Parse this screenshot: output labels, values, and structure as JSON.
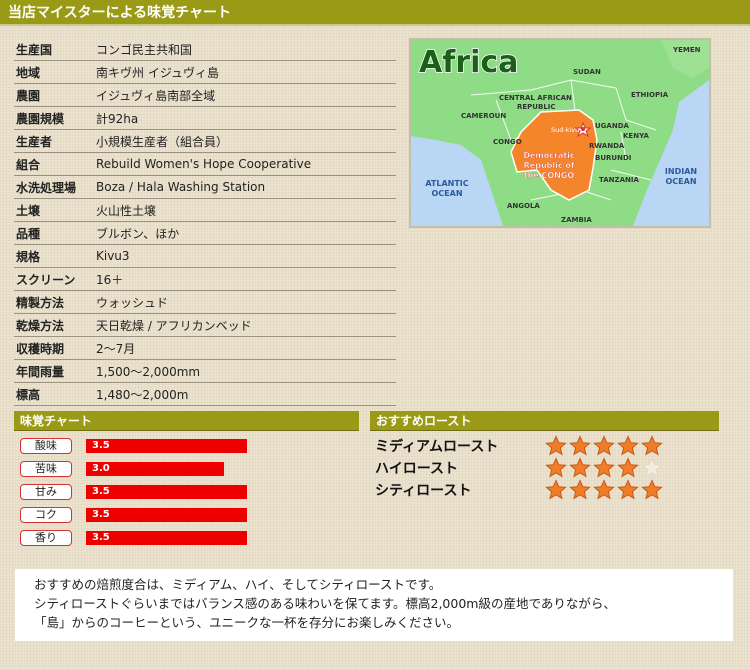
{
  "header": {
    "title": "当店マイスターによる味覚チャート"
  },
  "spec": [
    {
      "label": "生産国",
      "value": "コンゴ民主共和国"
    },
    {
      "label": "地域",
      "value": "南キヴ州 イジュヴィ島"
    },
    {
      "label": "農園",
      "value": "イジュヴィ島南部全域"
    },
    {
      "label": "農園規模",
      "value": "計92ha"
    },
    {
      "label": "生産者",
      "value": "小規模生産者（組合員）"
    },
    {
      "label": "組合",
      "value": "Rebuild Women's Hope Cooperative"
    },
    {
      "label": "水洗処理場",
      "value": "Boza / Hala Washing Station"
    },
    {
      "label": "土壌",
      "value": "火山性土壌"
    },
    {
      "label": "品種",
      "value": "ブルボン、ほか"
    },
    {
      "label": "規格",
      "value": "Kivu3"
    },
    {
      "label": "スクリーン",
      "value": "16＋"
    },
    {
      "label": "精製方法",
      "value": "ウォッシュド"
    },
    {
      "label": "乾燥方法",
      "value": "天日乾燥 / アフリカンベッド"
    },
    {
      "label": "収穫時期",
      "value": "2〜7月"
    },
    {
      "label": "年間雨量",
      "value": "1,500〜2,000mm"
    },
    {
      "label": "標高",
      "value": "1,480〜2,000m"
    }
  ],
  "map": {
    "title": "Africa",
    "labels": {
      "yemen": "YEMEN",
      "sudan": "SUDAN",
      "car1": "CENTRAL AFRICAN",
      "car2": "REPUBLIC",
      "ethiopia": "ETHIOPIA",
      "cameroun": "CAMEROUN",
      "uganda": "UGANDA",
      "kenya": "KENYA",
      "congo": "CONGO",
      "sudkivu": "Sud-kivu",
      "rwanda": "RWANDA",
      "burundi": "BURUNDI",
      "drc1": "Democratic",
      "drc2": "Republic of",
      "drc3": "the CONGO",
      "tanzania": "TANZANIA",
      "atlantic1": "ATLANTIC",
      "atlantic2": "OCEAN",
      "angola": "ANGOLA",
      "zambia": "ZAMBIA",
      "indian1": "INDIAN",
      "indian2": "OCEAN"
    },
    "colors": {
      "land": "#8fdc86",
      "sea": "#b9d7f5",
      "drc": "#f5852a",
      "border": "#ffffff"
    }
  },
  "taste": {
    "heading": "味覚チャート",
    "max": 5,
    "items": [
      {
        "label": "酸味",
        "value": 3.5,
        "text": "3.5"
      },
      {
        "label": "苦味",
        "value": 3.0,
        "text": "3.0"
      },
      {
        "label": "甘み",
        "value": 3.5,
        "text": "3.5"
      },
      {
        "label": "コク",
        "value": 3.5,
        "text": "3.5"
      },
      {
        "label": "香り",
        "value": 3.5,
        "text": "3.5"
      }
    ]
  },
  "roast": {
    "heading": "おすすめロースト",
    "max_stars": 5,
    "items": [
      {
        "name": "ミディアムロースト",
        "stars": 5
      },
      {
        "name": "ハイロースト",
        "stars": 4
      },
      {
        "name": "シティロースト",
        "stars": 5
      }
    ]
  },
  "comment": {
    "lines": [
      "おすすめの焙煎度合は、ミディアム、ハイ、そしてシティローストです。",
      "シティローストぐらいまではバランス感のある味わいを保てます。標高2,000m級の産地でありながら、",
      "「島」からのコーヒーという、ユニークな一杯を存分にお楽しみください。"
    ]
  },
  "colors": {
    "accent": "#9a9a16",
    "bar": "#ee0000",
    "star": "#f07d2a"
  }
}
